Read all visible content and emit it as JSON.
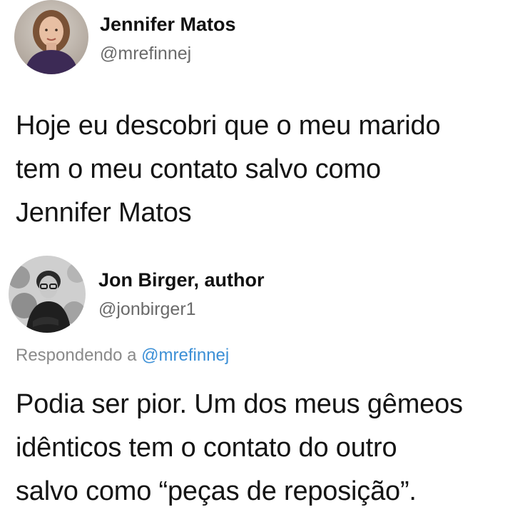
{
  "tweet1": {
    "author": {
      "name": "Jennifer Matos",
      "handle": "@mrefinnej"
    },
    "text_lines": [
      "Hoje eu descobri que o meu marido",
      "tem o meu contato salvo como",
      "Jennifer Matos"
    ]
  },
  "tweet2": {
    "author": {
      "name": "Jon Birger, author",
      "handle": "@jonbirger1"
    },
    "reply": {
      "prefix": "Respondendo a ",
      "mention": "@mrefinnej"
    },
    "text_lines": [
      "Podia ser pior. Um dos meus gêmeos",
      "idênticos tem o contato do outro",
      "salvo como “peças de reposição”."
    ]
  },
  "colors": {
    "mention": "#3b8fd6",
    "handle": "#6a6a6a",
    "text": "#141414"
  },
  "icons": {
    "avatar1": "profile-photo-woman",
    "avatar2": "profile-photo-man"
  }
}
